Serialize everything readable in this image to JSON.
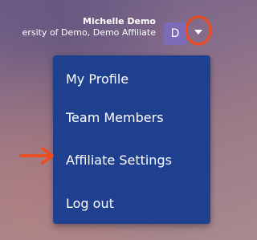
{
  "header": {
    "user_name": "Michelle Demo",
    "user_org": "ersity of Demo, Demo Affiliate",
    "avatar_letter": "D"
  },
  "menu": {
    "items": [
      {
        "label": "My Profile"
      },
      {
        "label": "Team Members"
      },
      {
        "label": "Affiliate Settings"
      },
      {
        "label": "Log out"
      }
    ]
  },
  "colors": {
    "menu_bg": "#1f3f8f",
    "avatar_bg": "#7b6bb8",
    "annotation": "#f04a1a"
  },
  "icons": {
    "dropdown": "caret-down-icon",
    "pointer": "arrow-right-annotation-icon"
  }
}
